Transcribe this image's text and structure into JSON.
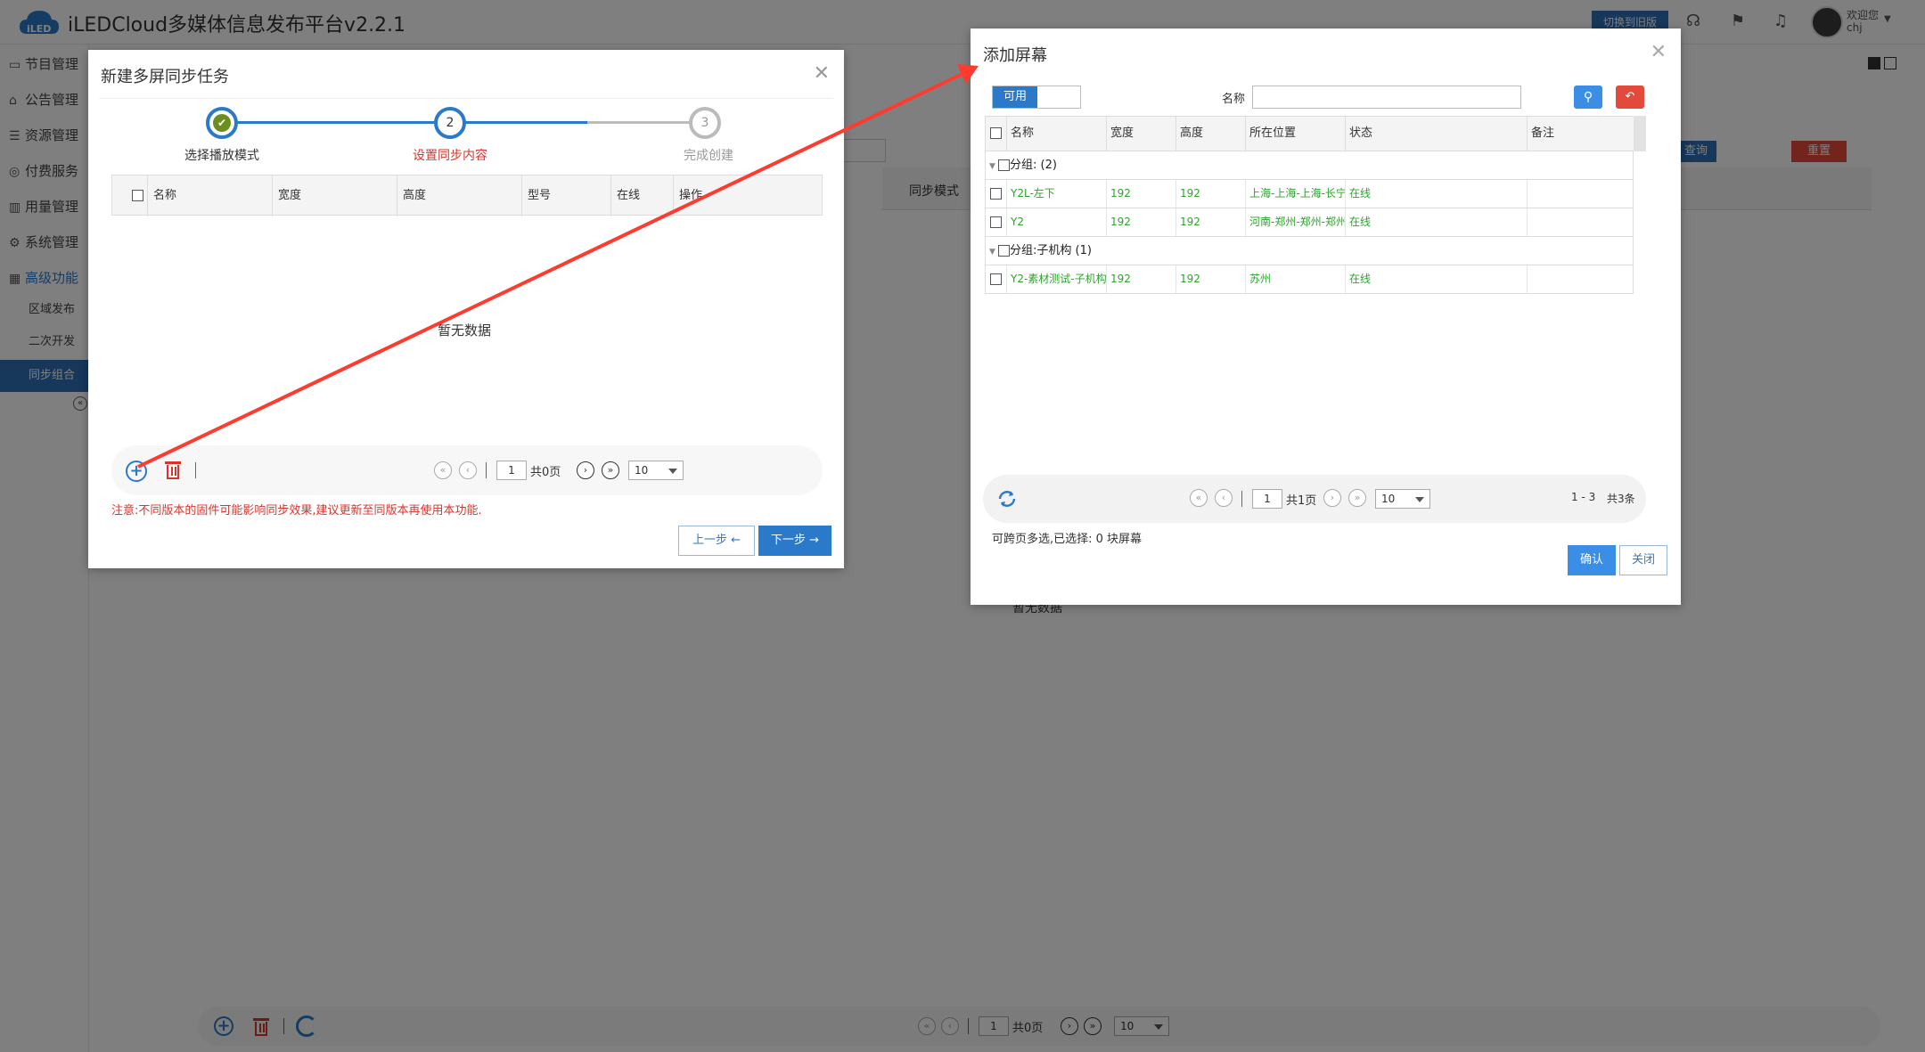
{
  "app": {
    "title": "iLEDCloud多媒体信息发布平台v2.2.1",
    "logo_text": "iLED",
    "switch_label": "切换到旧版",
    "welcome": "欢迎您",
    "username": "chj"
  },
  "sidebar": {
    "items": [
      {
        "label": "节目管理",
        "icon": "monitor-icon"
      },
      {
        "label": "公告管理",
        "icon": "home-icon"
      },
      {
        "label": "资源管理",
        "icon": "server-icon"
      },
      {
        "label": "付费服务",
        "icon": "coin-icon"
      },
      {
        "label": "用量管理",
        "icon": "bar-chart-icon"
      },
      {
        "label": "系统管理",
        "icon": "gear-icon"
      },
      {
        "label": "高级功能",
        "icon": "grid-icon"
      }
    ],
    "sub_items": [
      {
        "label": "区域发布"
      },
      {
        "label": "二次开发"
      },
      {
        "label": "同步组合"
      }
    ]
  },
  "background": {
    "sync_mode_label": "同步模式",
    "query_label": "查询",
    "reset_label": "重置",
    "no_data": "暂无数据",
    "pager": {
      "page": "1",
      "total_pages": "共0页",
      "page_size": "10"
    }
  },
  "wizard": {
    "title": "新建多屏同步任务",
    "steps": [
      {
        "number": "✔",
        "label": "选择播放模式",
        "state": "done"
      },
      {
        "number": "2",
        "label": "设置同步内容",
        "state": "active"
      },
      {
        "number": "3",
        "label": "完成创建",
        "state": "pending"
      }
    ],
    "columns": [
      "名称",
      "宽度",
      "高度",
      "型号",
      "在线",
      "操作"
    ],
    "no_data": "暂无数据",
    "pager": {
      "page": "1",
      "total_pages": "共0页",
      "page_size": "10"
    },
    "note": "注意:不同版本的固件可能影响同步效果,建议更新至同版本再使用本功能.",
    "prev_label": "上一步",
    "next_label": "下一步"
  },
  "add_screen": {
    "title": "添加屏幕",
    "toggle_label": "可用",
    "name_label": "名称",
    "name_value": "",
    "columns": [
      "名称",
      "宽度",
      "高度",
      "所在位置",
      "状态",
      "备注"
    ],
    "groups": [
      {
        "label": "分组: (2)",
        "rows": [
          {
            "name": "Y2L-左下",
            "width": "192",
            "height": "192",
            "location": "上海-上海-上海-长宁",
            "status": "在线",
            "remark": ""
          },
          {
            "name": "Y2",
            "width": "192",
            "height": "192",
            "location": "河南-郑州-郑州-郑州",
            "status": "在线",
            "remark": ""
          }
        ]
      },
      {
        "label": "分组:子机构 (1)",
        "rows": [
          {
            "name": "Y2-素材测试-子机构",
            "width": "192",
            "height": "192",
            "location": "苏州",
            "status": "在线",
            "remark": ""
          }
        ]
      }
    ],
    "pager": {
      "page": "1",
      "total_pages": "共1页",
      "page_size": "10",
      "range": "1 - 3",
      "total": "共3条"
    },
    "selected_text": "可跨页多选,已选择:  0 块屏幕",
    "confirm_label": "确认",
    "close_label": "关闭"
  },
  "colors": {
    "primary": "#2b79c9",
    "danger": "#e24a3b",
    "success": "#2aa52a",
    "step_done": "#6b8f1f",
    "arrow": "#ff3b30"
  }
}
